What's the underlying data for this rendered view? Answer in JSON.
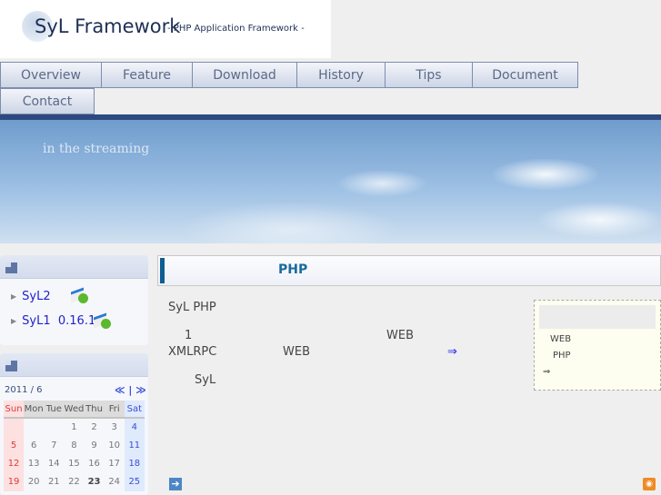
{
  "header": {
    "logo_title": "SyL Framework",
    "logo_subtitle": "- PHP Application Framework -"
  },
  "nav": {
    "items": [
      "Overview",
      "Feature",
      "Download",
      "History",
      "Tips",
      "Document",
      "Contact"
    ]
  },
  "banner": {
    "tagline": "in the streaming"
  },
  "sidebar": {
    "downloads": [
      {
        "label": "SyL2",
        "icon": "download-icon"
      },
      {
        "label": "SyL1  0.16.1",
        "icon": "download-icon"
      }
    ],
    "calendar": {
      "title": "2011 / 6",
      "prev": "≪",
      "sep": "|",
      "next": "≫",
      "weekdays": [
        "Sun",
        "Mon",
        "Tue",
        "Wed",
        "Thu",
        "Fri",
        "Sat"
      ],
      "weeks": [
        [
          "",
          "",
          "",
          "1",
          "2",
          "3",
          "4"
        ],
        [
          "5",
          "6",
          "7",
          "8",
          "9",
          "10",
          "11"
        ],
        [
          "12",
          "13",
          "14",
          "15",
          "16",
          "17",
          "18"
        ],
        [
          "19",
          "20",
          "21",
          "22",
          "23",
          "24",
          "25"
        ]
      ],
      "today": "23"
    }
  },
  "main": {
    "title": "PHP",
    "lines": [
      "SyL PHP",
      "1",
      "WEB",
      "XMLRPC",
      "WEB",
      "⇒",
      "SyL"
    ],
    "note": {
      "line1": "WEB",
      "line2": "PHP",
      "arrow": "⇒"
    }
  },
  "colors": {
    "accent": "#0e5e93",
    "nav_dark": "#2c4a80",
    "link": "#2222cc"
  }
}
